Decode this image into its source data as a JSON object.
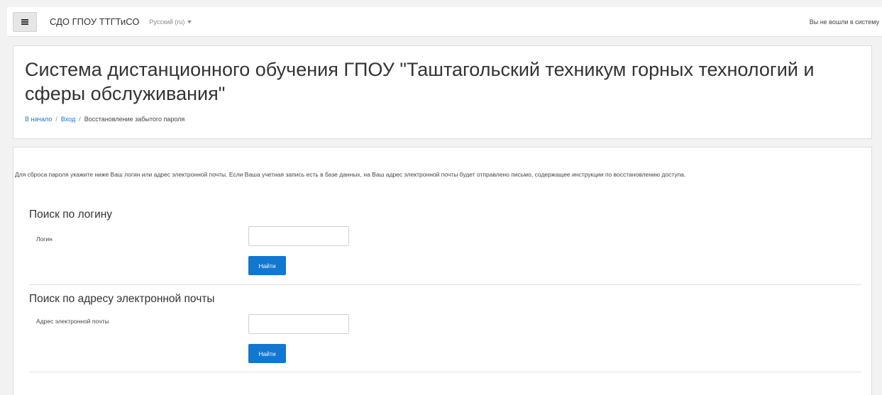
{
  "navbar": {
    "menu_icon": "hamburger-menu-icon",
    "site_name": "СДО ГПОУ ТТГТиСО",
    "language": "Русский (ru)",
    "login_status": "Вы не вошли в систему"
  },
  "header": {
    "title": "Система дистанционного обучения ГПОУ \"Таштагольский техникум горных технологий и сферы обслуживания\"",
    "breadcrumb": {
      "home": "В начало",
      "login": "Вход",
      "current": "Восстановление забытого пароля",
      "separator": "/"
    }
  },
  "main": {
    "instructions": "Для сброса пароля укажите ниже Ваш логин или адрес электронной почты. Если Ваша учетная запись есть в базе данных, на Ваш адрес электронной почты будет отправлено письмо, содержащее инструкции по восстановлению доступа.",
    "username_section": {
      "title": "Поиск по логину",
      "label": "Логин",
      "value": "",
      "button": "Найти"
    },
    "email_section": {
      "title": "Поиск по адресу электронной почты",
      "label": "Адрес электронной почты",
      "value": "",
      "button": "Найти"
    }
  },
  "colors": {
    "accent": "#1177d1",
    "background": "#f2f2f2",
    "card": "#ffffff"
  }
}
